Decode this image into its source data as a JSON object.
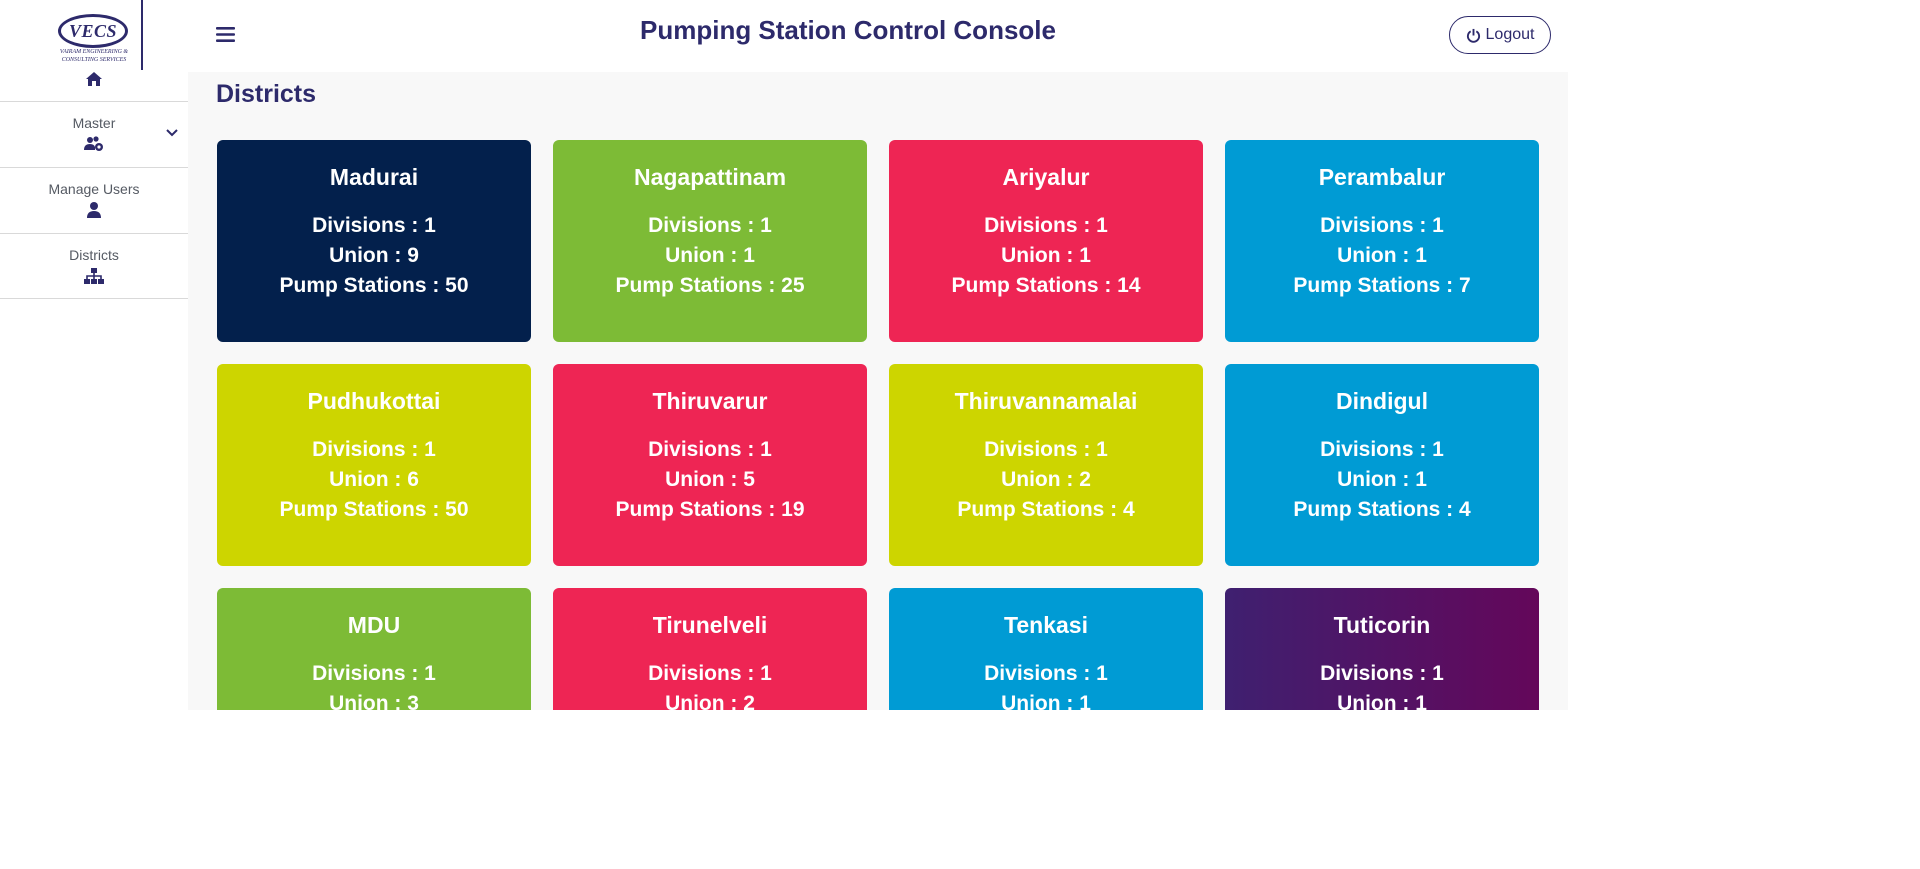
{
  "app": {
    "title": "Pumping Station Control Console",
    "logout_label": "Logout"
  },
  "logo": {
    "text": "VECS",
    "subtitle": "VAIRAM ENGINEERING & CONSULTING SERVICES"
  },
  "sidebar": {
    "items": [
      {
        "label": "Master",
        "icon": "users-cog-icon"
      },
      {
        "label": "Manage Users",
        "icon": "user-icon"
      },
      {
        "label": "Districts",
        "icon": "sitemap-icon"
      }
    ]
  },
  "page": {
    "title": "Districts"
  },
  "colors": {
    "brand": "#2d2a6b",
    "navy": "#03204c",
    "green": "#7dbb36",
    "red": "#ee2554",
    "blue": "#009bd4",
    "lime": "#cdd500",
    "purple_start": "#3f2070",
    "purple_end": "#64075a"
  },
  "districts": [
    {
      "name": "Madurai",
      "divisions": "Divisions : 1",
      "union": "Union : 9",
      "pumps": "Pump Stations : 50",
      "color": "navy"
    },
    {
      "name": "Nagapattinam",
      "divisions": "Divisions : 1",
      "union": "Union : 1",
      "pumps": "Pump Stations : 25",
      "color": "green"
    },
    {
      "name": "Ariyalur",
      "divisions": "Divisions : 1",
      "union": "Union : 1",
      "pumps": "Pump Stations : 14",
      "color": "red"
    },
    {
      "name": "Perambalur",
      "divisions": "Divisions : 1",
      "union": "Union : 1",
      "pumps": "Pump Stations : 7",
      "color": "blue"
    },
    {
      "name": "Pudhukottai",
      "divisions": "Divisions : 1",
      "union": "Union : 6",
      "pumps": "Pump Stations : 50",
      "color": "lime"
    },
    {
      "name": "Thiruvarur",
      "divisions": "Divisions : 1",
      "union": "Union : 5",
      "pumps": "Pump Stations : 19",
      "color": "red"
    },
    {
      "name": "Thiruvannamalai",
      "divisions": "Divisions : 1",
      "union": "Union : 2",
      "pumps": "Pump Stations : 4",
      "color": "lime"
    },
    {
      "name": "Dindigul",
      "divisions": "Divisions : 1",
      "union": "Union : 1",
      "pumps": "Pump Stations : 4",
      "color": "blue"
    },
    {
      "name": "MDU",
      "divisions": "Divisions : 1",
      "union": "Union : 3",
      "pumps": "",
      "color": "green"
    },
    {
      "name": "Tirunelveli",
      "divisions": "Divisions : 1",
      "union": "Union : 2",
      "pumps": "",
      "color": "red"
    },
    {
      "name": "Tenkasi",
      "divisions": "Divisions : 1",
      "union": "Union : 1",
      "pumps": "",
      "color": "blue"
    },
    {
      "name": "Tuticorin",
      "divisions": "Divisions : 1",
      "union": "Union : 1",
      "pumps": "",
      "color": "purple"
    }
  ]
}
